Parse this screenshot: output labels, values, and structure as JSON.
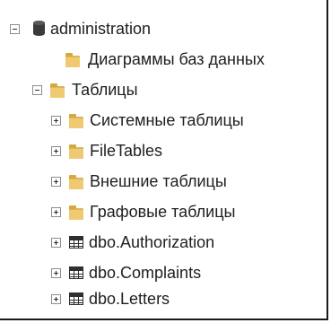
{
  "tree": {
    "root": {
      "label": "administration",
      "icon": "database-icon",
      "expanded": true
    },
    "diagrams": {
      "label": "Диаграммы баз данных",
      "icon": "folder-icon"
    },
    "tables": {
      "label": "Таблицы",
      "icon": "folder-icon",
      "expanded": true,
      "children": [
        {
          "label": "Системные таблицы",
          "icon": "folder-icon"
        },
        {
          "label": "FileTables",
          "icon": "folder-icon"
        },
        {
          "label": "Внешние таблицы",
          "icon": "folder-icon"
        },
        {
          "label": "Графовые таблицы",
          "icon": "folder-icon"
        },
        {
          "label": "dbo.Authorization",
          "icon": "table-icon"
        },
        {
          "label": "dbo.Complaints",
          "icon": "table-icon"
        },
        {
          "label": "dbo.Letters",
          "icon": "table-icon"
        }
      ]
    }
  },
  "colors": {
    "folder": "#f0ca72",
    "text": "#1e1e1e",
    "border": "#1a1a1a"
  }
}
